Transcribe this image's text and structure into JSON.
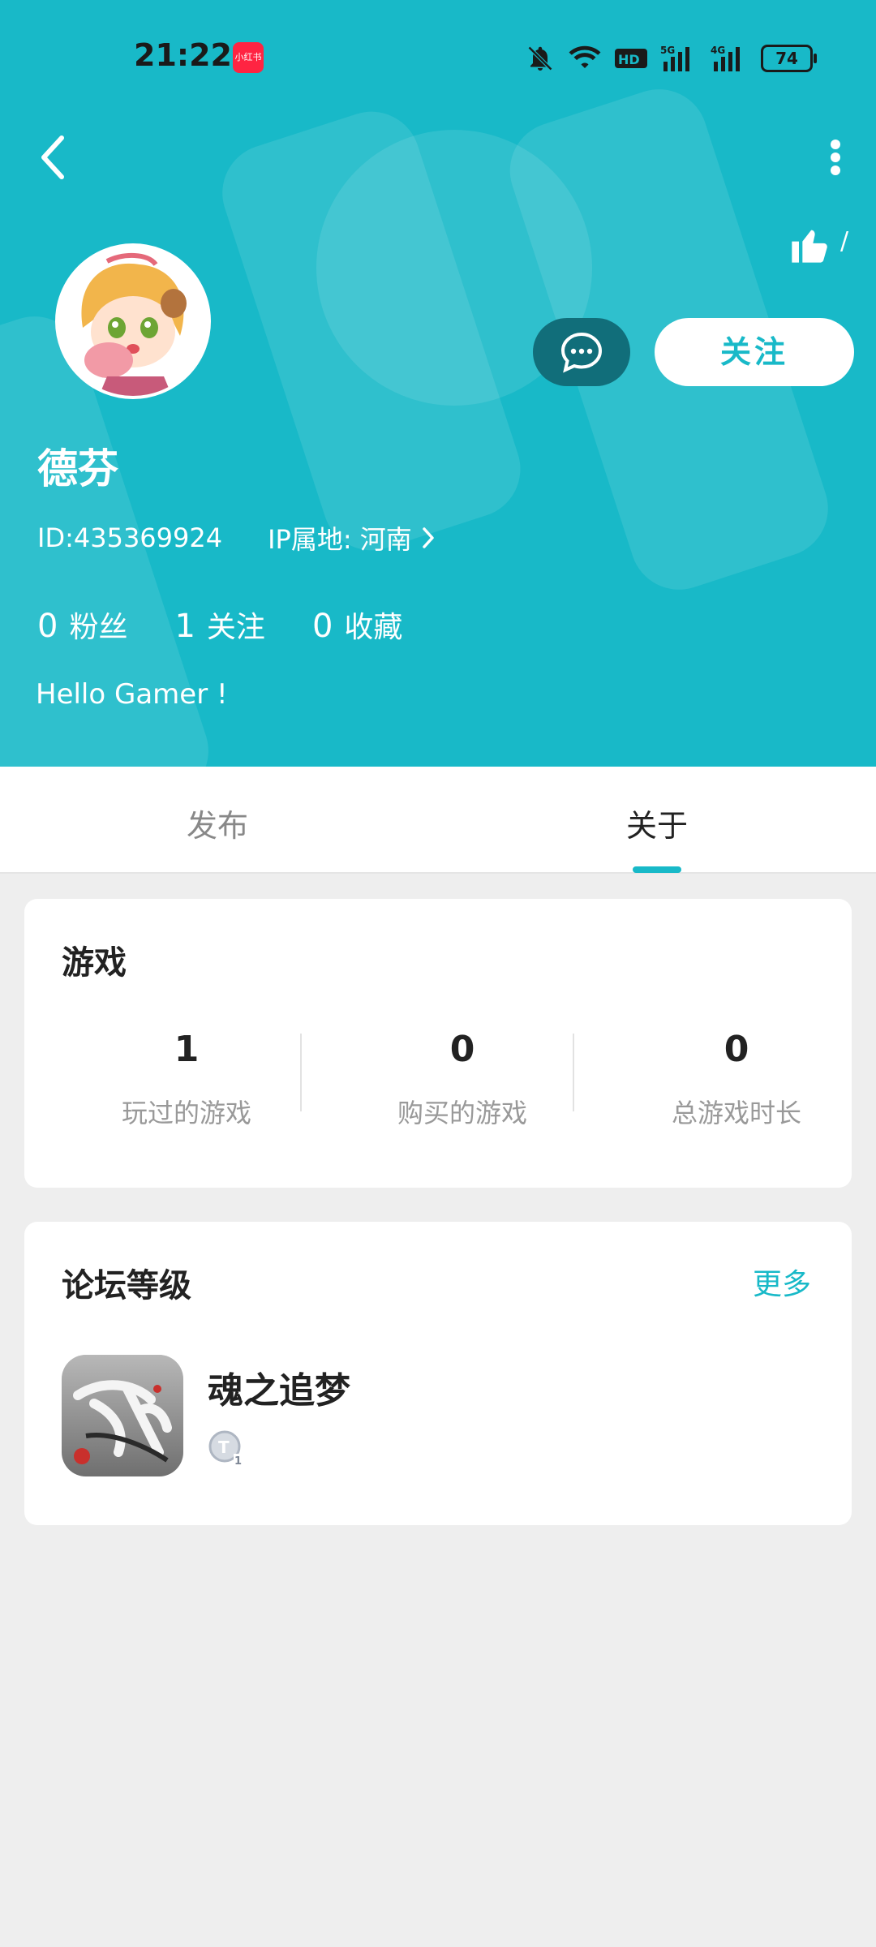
{
  "status_bar": {
    "time": "21:22",
    "app_badge": "小红书",
    "icons": [
      "bell-off-icon",
      "wifi-icon",
      "hd-icon",
      "5g-signal-icon",
      "4g-signal-icon"
    ],
    "battery": "74"
  },
  "colors": {
    "accent": "#18b9c8",
    "message_btn": "#116e7a",
    "page_bg": "#eeeeee"
  },
  "profile": {
    "like_count": "/",
    "follow_label": "关注",
    "nickname": "德芬",
    "id_text": "ID:435369924",
    "ip_text": "IP属地: 河南",
    "stats": [
      {
        "num": "0",
        "label": "粉丝"
      },
      {
        "num": "1",
        "label": "关注"
      },
      {
        "num": "0",
        "label": "收藏"
      }
    ],
    "bio": "Hello Gamer !"
  },
  "tabs": [
    {
      "label": "发布",
      "active": false
    },
    {
      "label": "关于",
      "active": true
    }
  ],
  "games_card": {
    "title": "游戏",
    "stats": [
      {
        "value": "1",
        "label": "玩过的游戏"
      },
      {
        "value": "0",
        "label": "购买的游戏"
      },
      {
        "value": "0",
        "label": "总游戏时长"
      }
    ]
  },
  "forum_card": {
    "title": "论坛等级",
    "more_label": "更多",
    "game_name": "魂之追梦"
  }
}
